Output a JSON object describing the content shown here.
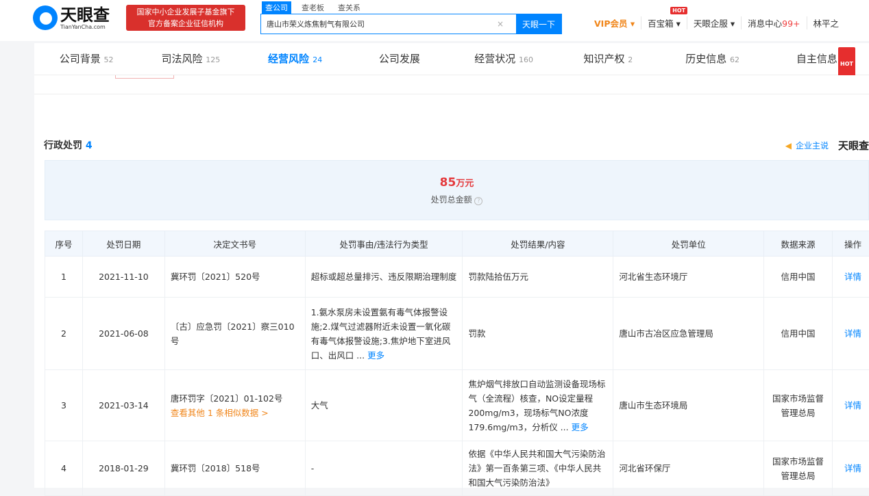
{
  "header": {
    "logo": "天眼查",
    "logo_en": "TianYanCha.com",
    "badge_line1": "国家中小企业发展子基金旗下",
    "badge_line2": "官方备案企业征信机构",
    "search_tabs": [
      "查公司",
      "查老板",
      "查关系"
    ],
    "search_value": "唐山市荣义炼焦制气有限公司",
    "clear": "×",
    "search_button": "天眼一下",
    "nav": {
      "vip": "VIP会员 ▾",
      "box": "百宝箱 ▾",
      "service": "天眼企服 ▾",
      "msg": "消息中心",
      "msg_count": "99+",
      "user": "林平之",
      "hot": "HOT"
    }
  },
  "tabs": [
    {
      "label": "公司背景",
      "count": "52"
    },
    {
      "label": "司法风险",
      "count": "125"
    },
    {
      "label": "经营风险",
      "count": "24"
    },
    {
      "label": "公司发展",
      "count": ""
    },
    {
      "label": "经营状况",
      "count": "160"
    },
    {
      "label": "知识产权",
      "count": "2"
    },
    {
      "label": "历史信息",
      "count": "62"
    },
    {
      "label": "自主信息",
      "count": ""
    }
  ],
  "section": {
    "title": "行政处罚",
    "count": "4",
    "say": "企业主说",
    "brand": "天眼查",
    "total_amount": "85",
    "total_unit": "万元",
    "total_label": "处罚总金额",
    "help": "?"
  },
  "table": {
    "headers": [
      "序号",
      "处罚日期",
      "决定文书号",
      "处罚事由/违法行为类型",
      "处罚结果/内容",
      "处罚单位",
      "数据来源",
      "操作"
    ],
    "rows": [
      {
        "no": "1",
        "date": "2021-11-10",
        "doc": "冀环罚〔2021〕520号",
        "doc_extra": "",
        "reason": "超标或超总量排污、违反限期治理制度",
        "reason_more": "",
        "result": "罚款陆拾伍万元",
        "result_more": "",
        "unit": "河北省生态环境厅",
        "source": "信用中国",
        "action": "详情"
      },
      {
        "no": "2",
        "date": "2021-06-08",
        "doc": "〔古〕应急罚〔2021〕察三010号",
        "doc_extra": "",
        "reason": "1.氨水泵房未设置氨有毒气体报警设施;2.煤气过滤器附近未设置一氧化碳有毒气体报警设施;3.焦炉地下室进风口、出风口 ...",
        "reason_more": "更多",
        "result": "罚款",
        "result_more": "",
        "unit": "唐山市古冶区应急管理局",
        "source": "信用中国",
        "action": "详情"
      },
      {
        "no": "3",
        "date": "2021-03-14",
        "doc": "唐环罚字〔2021〕01-102号",
        "doc_extra": "查看其他 1 条相似数据 >",
        "reason": "大气",
        "reason_more": "",
        "result": "焦炉烟气排放口自动监测设备现场标气（全流程）核查，NO设定量程200mg/m3，现场标气NO浓度179.6mg/m3，分析仪 ...",
        "result_more": "更多",
        "unit": "唐山市生态环境局",
        "source": "国家市场监督管理总局",
        "action": "详情"
      },
      {
        "no": "4",
        "date": "2018-01-29",
        "doc": "冀环罚〔2018〕518号",
        "doc_extra": "",
        "reason": "-",
        "reason_more": "",
        "result": "依据《中华人民共和国大气污染防治法》第一百条第三项、《中华人民共和国大气污染防治法》",
        "result_more": "",
        "unit": "河北省环保厅",
        "source": "国家市场监督管理总局",
        "action": "详情"
      }
    ]
  }
}
